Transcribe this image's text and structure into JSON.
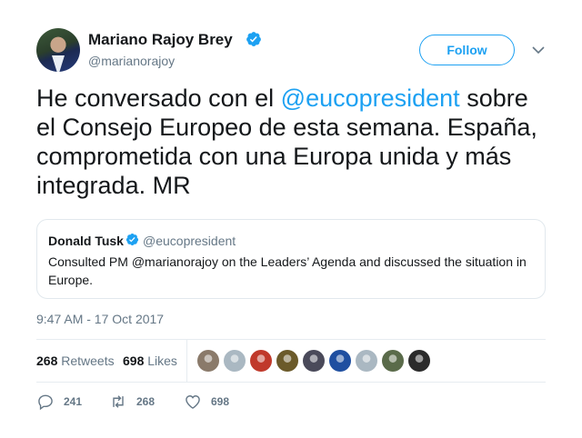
{
  "author": {
    "name": "Mariano Rajoy Brey",
    "handle": "@marianorajoy",
    "follow_label": "Follow"
  },
  "tweet": {
    "text_before": "He conversado con el ",
    "mention": "@eucopresident",
    "text_after": " sobre el Consejo Europeo de esta semana. España, comprometida con una Europa unida y más integrada. MR",
    "timestamp": "9:47 AM - 17 Oct 2017"
  },
  "quoted": {
    "name": "Donald Tusk",
    "handle": "@eucopresident",
    "text": "Consulted PM @marianorajoy on the Leaders’ Agenda and discussed the situation in Europe."
  },
  "stats": {
    "retweets_count": "268",
    "retweets_label": "Retweets",
    "likes_count": "698",
    "likes_label": "Likes"
  },
  "likers": [
    {
      "color": "#8a7a6a"
    },
    {
      "color": "#aab8c2"
    },
    {
      "color": "#c0392b"
    },
    {
      "color": "#6b5a2a"
    },
    {
      "color": "#4a4a5a"
    },
    {
      "color": "#1f4fa0"
    },
    {
      "color": "#aab8c2"
    },
    {
      "color": "#5a6b4a"
    },
    {
      "color": "#2b2b2b"
    }
  ],
  "actions": {
    "replies": "241",
    "retweets": "268",
    "likes": "698"
  },
  "colors": {
    "accent": "#1da1f2",
    "muted": "#657786",
    "text": "#14171a",
    "border": "#e1e8ed"
  }
}
